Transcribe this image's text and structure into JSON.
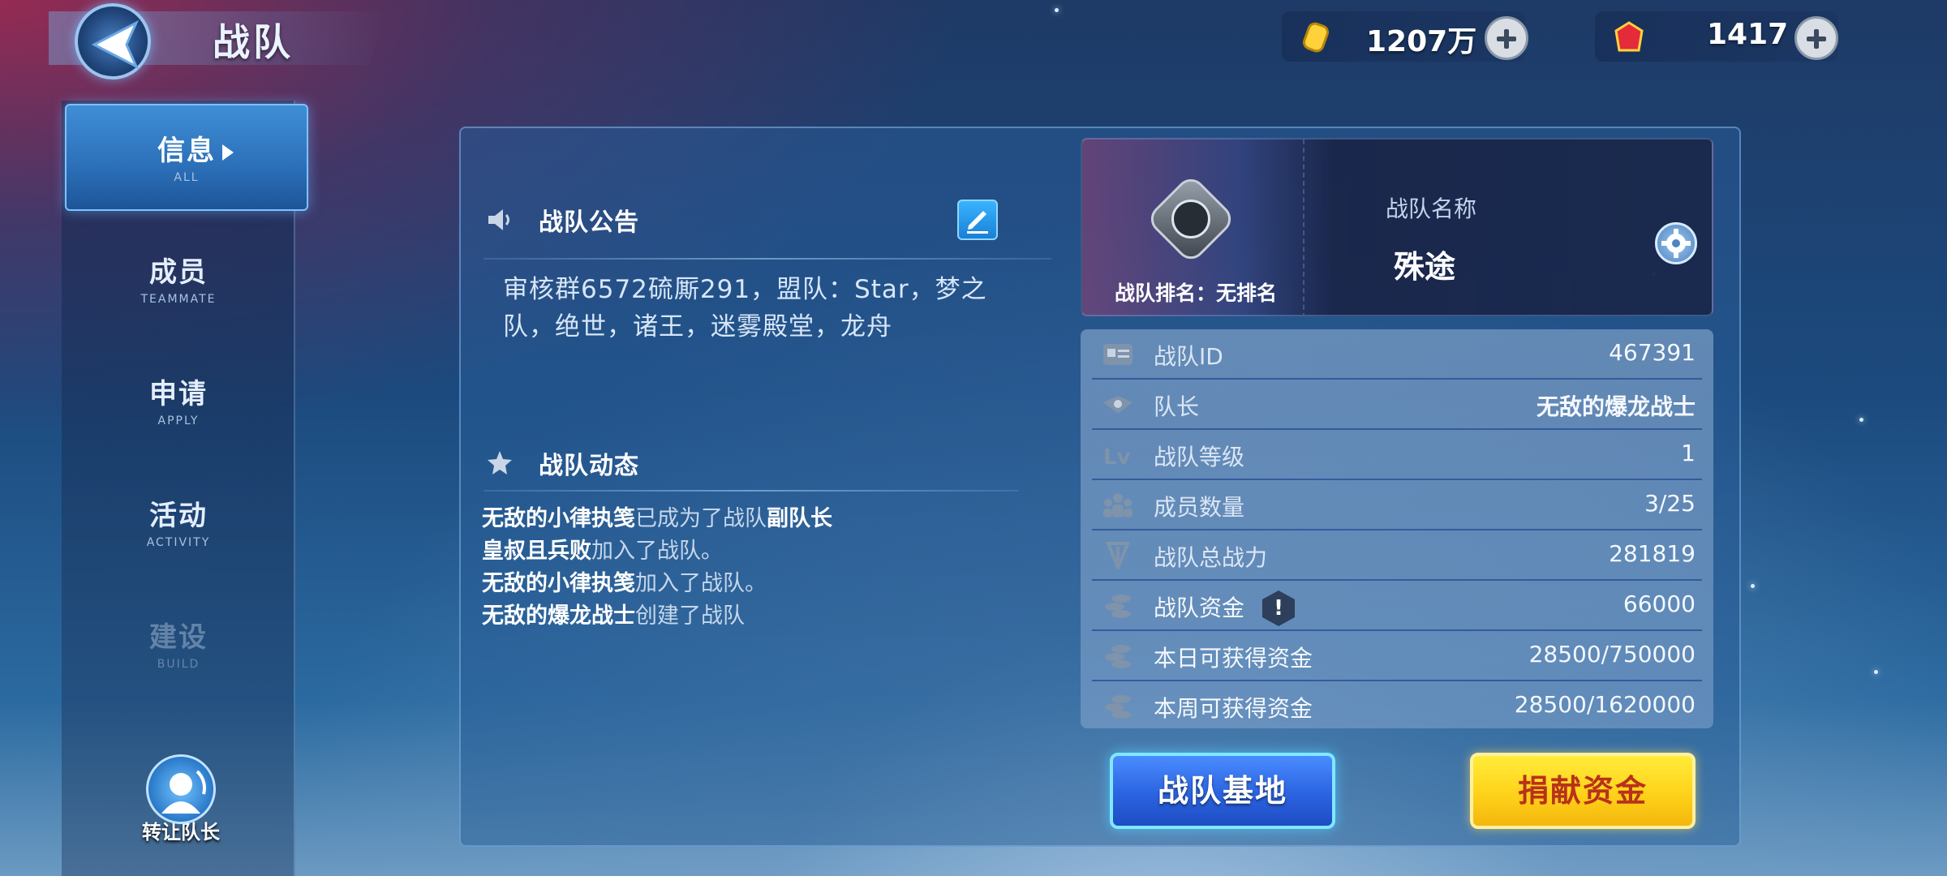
{
  "header": {
    "title": "战队",
    "gold_amount": "1207万",
    "gem_amount": "1417"
  },
  "sidebar": {
    "items": [
      {
        "label": "信息",
        "sub": "ALL"
      },
      {
        "label": "成员",
        "sub": "TEAMMATE"
      },
      {
        "label": "申请",
        "sub": "APPLY"
      },
      {
        "label": "活动",
        "sub": "ACTIVITY"
      },
      {
        "label": "建设",
        "sub": "BUILD"
      }
    ],
    "transfer_label": "转让队长"
  },
  "announcement": {
    "title": "战队公告",
    "text": "审核群6572硫厮291，盟队：Star，梦之队，绝世，诸王，迷雾殿堂，龙舟"
  },
  "feed": {
    "title": "战队动态",
    "lines": [
      {
        "who": "无敌的小律执笺",
        "act": "已成为了战队",
        "role": "副队长"
      },
      {
        "who": "皇叔且兵败",
        "act": "加入了战队。",
        "role": ""
      },
      {
        "who": "无敌的小律执笺",
        "act": "加入了战队。",
        "role": ""
      },
      {
        "who": "无敌的爆龙战士",
        "act": "创建了战队",
        "role": ""
      }
    ]
  },
  "team": {
    "rank_label": "战队排名：无排名",
    "name_heading": "战队名称",
    "name": "殊途"
  },
  "stats": [
    {
      "label": "战队ID",
      "value": "467391",
      "icon": "id-card-icon"
    },
    {
      "label": "队长",
      "value": "无敌的爆龙战士",
      "icon": "captain-emblem-icon"
    },
    {
      "label": "战队等级",
      "value": "1",
      "icon": "level-icon"
    },
    {
      "label": "成员数量",
      "value": "3/25",
      "icon": "members-icon"
    },
    {
      "label": "战队总战力",
      "value": "281819",
      "icon": "power-icon"
    },
    {
      "label": "战队资金",
      "value": "66000",
      "icon": "coins-icon"
    },
    {
      "label": "本日可获得资金",
      "value": "28500/750000",
      "icon": "coins-icon"
    },
    {
      "label": "本周可获得资金",
      "value": "28500/1620000",
      "icon": "coins-icon"
    }
  ],
  "buttons": {
    "base": "战队基地",
    "donate": "捐献资金"
  },
  "colors": {
    "accent_blue": "#2b63e0",
    "accent_yellow": "#ffd21a",
    "donate_text": "#b8321a"
  }
}
